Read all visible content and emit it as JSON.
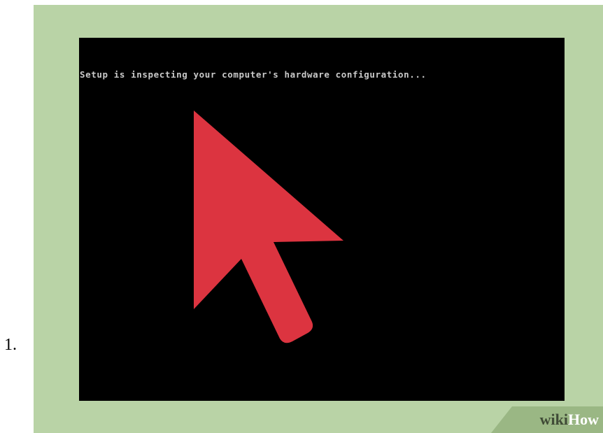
{
  "step": {
    "number": "1."
  },
  "screen": {
    "text": "Setup is inspecting your computer's hardware configuration..."
  },
  "illustration": {
    "cursor_icon": "arrow-pointer-icon",
    "cursor_color": "#dc3440",
    "frame_color": "#b9d3a6",
    "screen_color": "#000000"
  },
  "watermark": {
    "part1": "wiki",
    "part2": "How"
  }
}
